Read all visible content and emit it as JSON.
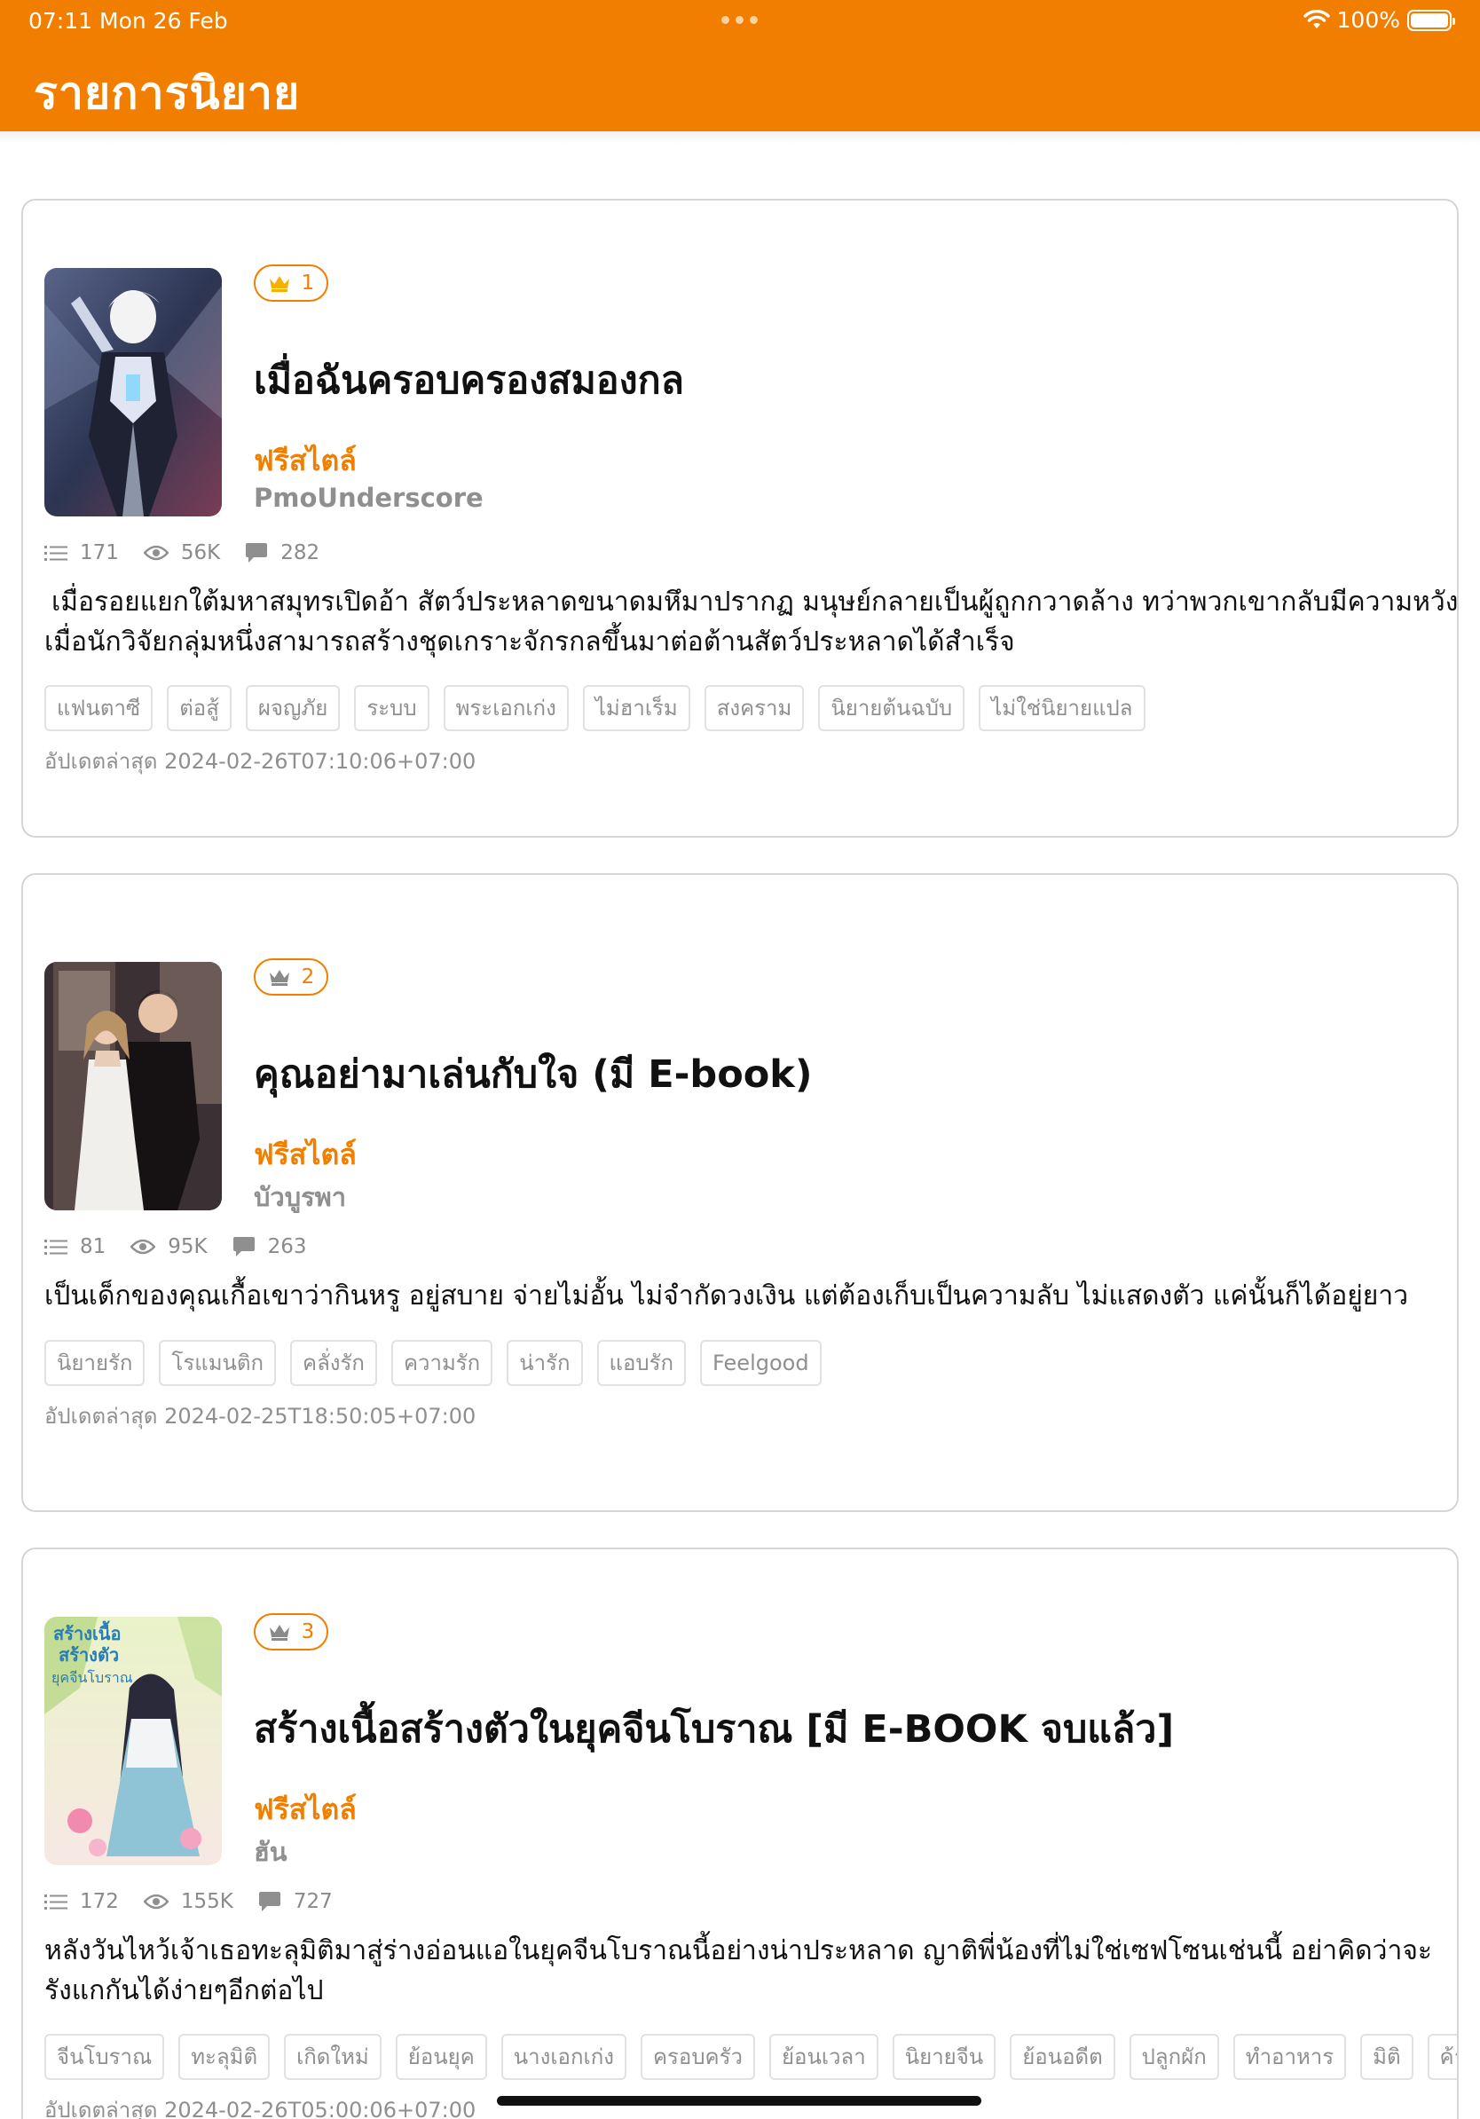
{
  "status_bar": {
    "time": "07:11",
    "date": "Mon 26 Feb",
    "battery": "100%",
    "icons": [
      "wifi-icon",
      "battery-icon"
    ]
  },
  "header": {
    "title": "รายการนิยาย",
    "background": "#f27e00"
  },
  "labels": {
    "updated_prefix": "อัปเดตล่าสุด"
  },
  "novels": [
    {
      "rank": "1",
      "title": "เมื่อฉันครอบครองสมองกล",
      "category": "ฟรีสไตล์",
      "author": "PmoUnderscore",
      "chapters": "171",
      "views": "56K",
      "comments": "282",
      "description": "เมื่อรอยแยกใต้มหาสมุทรเปิดอ้า สัตว์ประหลาดขนาดมหึมาปรากฏ มนุษย์กลายเป็นผู้ถูกกวาดล้าง ทว่าพวกเขากลับมีความหวังเมื่อนักวิจัยกลุ่มหนึ่งสามารถสร้างชุดเกราะจักรกลขึ้นมาต่อต้านสัตว์ประหลาดได้สำเร็จ",
      "tags": [
        "แฟนตาซี",
        "ต่อสู้",
        "ผจญภัย",
        "ระบบ",
        "พระเอกเก่ง",
        "ไม่ฮาเร็ม",
        "สงคราม",
        "นิยายต้นฉบับ",
        "ไม่ใช่นิยายแปล"
      ],
      "updated": "2024-02-26T07:10:06+07:00"
    },
    {
      "rank": "2",
      "title": "คุณอย่ามาเล่นกับใจ (มี E-book)",
      "category": "ฟรีสไตล์",
      "author": "บัวบูรพา",
      "chapters": "81",
      "views": "95K",
      "comments": "263",
      "description": "เป็นเด็กของคุณเกื้อเขาว่ากินหรู อยู่สบาย จ่ายไม่อั้น ไม่จำกัดวงเงิน แต่ต้องเก็บเป็นความลับ ไม่แสดงตัว แค่นั้นก็ได้อยู่ยาว",
      "tags": [
        "นิยายรัก",
        "โรแมนติก",
        "คลั่งรัก",
        "ความรัก",
        "น่ารัก",
        "แอบรัก",
        "Feelgood"
      ],
      "updated": "2024-02-25T18:50:05+07:00"
    },
    {
      "rank": "3",
      "title": "สร้างเนื้อสร้างตัวในยุคจีนโบราณ [มี E-BOOK จบแล้ว]",
      "category": "ฟรีสไตล์",
      "author": "ฮัน",
      "chapters": "172",
      "views": "155K",
      "comments": "727",
      "description": "หลังวันไหว้เจ้าเธอทะลุมิติมาสู่ร่างอ่อนแอในยุคจีนโบราณนี้อย่างน่าประหลาด ญาติพี่น้องที่ไม่ใช่เซฟโซนเช่นนี้ อย่าคิดว่าจะรังแกกันได้ง่ายๆอีกต่อไป",
      "tags": [
        "จีนโบราณ",
        "ทะลุมิติ",
        "เกิดใหม่",
        "ย้อนยุค",
        "นางเอกเก่ง",
        "ครอบครัว",
        "ย้อนเวลา",
        "นิยายจีน",
        "ย้อนอดีต",
        "ปลูกผัก",
        "ทำอาหาร",
        "มิติ",
        "ค้าขาย"
      ],
      "updated": "2024-02-26T05:00:06+07:00",
      "cover_text": [
        "สร้างเนื้อ",
        "สร้างตัว",
        "ยุคจีนโบราณ"
      ]
    }
  ]
}
